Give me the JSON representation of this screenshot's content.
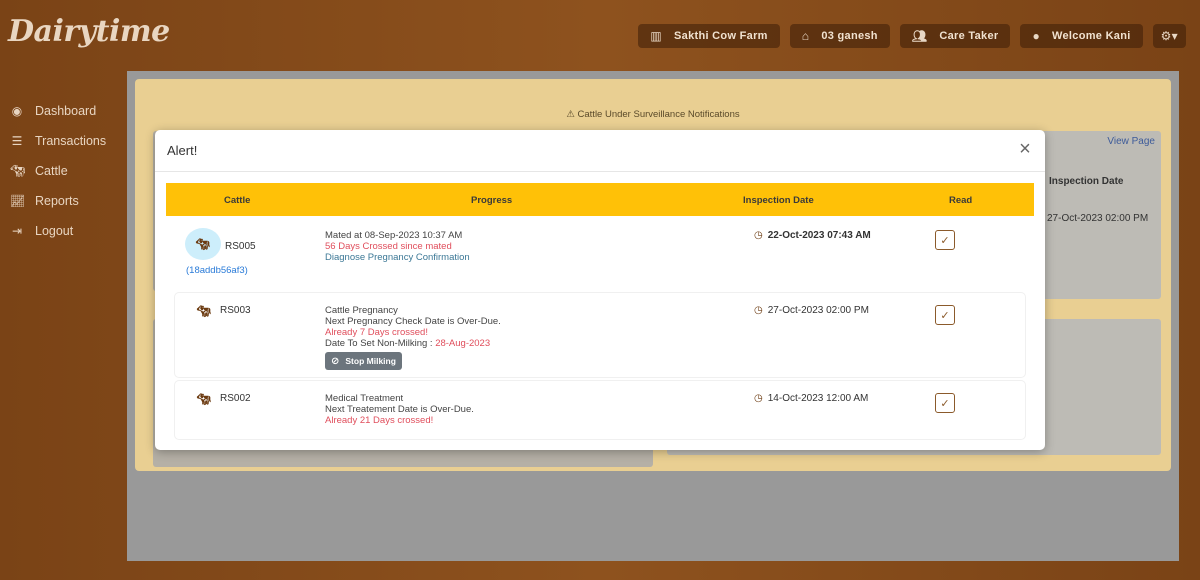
{
  "app": {
    "logo": "Dairytime"
  },
  "topbar": {
    "farm": "Sakthi Cow Farm",
    "shed": "03 ganesh",
    "role": "Care Taker",
    "welcome": "Welcome Kani"
  },
  "sidebar": {
    "items": [
      {
        "label": "Dashboard",
        "icon": "dashboard-icon"
      },
      {
        "label": "Transactions",
        "icon": "list-icon"
      },
      {
        "label": "Cattle",
        "icon": "cow-icon"
      },
      {
        "label": "Reports",
        "icon": "chart-icon"
      },
      {
        "label": "Logout",
        "icon": "logout-icon"
      }
    ]
  },
  "background": {
    "surveillance_title": "Cattle Under Surveillance Notifications",
    "view_page": "View Page",
    "inspection_date_header": "Inspection Date",
    "inspection_date_value": "27-Oct-2023 02:00 PM"
  },
  "modal": {
    "title": "Alert!",
    "close_symbol": "×",
    "columns": [
      "Cattle",
      "Progress",
      "Inspection Date",
      "Read"
    ],
    "rows": [
      {
        "cattle": "RS005",
        "tag": "(18addb56af3)",
        "line1": "Mated at 08-Sep-2023 10:37 AM",
        "line2": "56 Days Crossed since mated",
        "line3": "Diagnose Pregnancy Confirmation",
        "inspection": "22-Oct-2023 07:43 AM",
        "read": true
      },
      {
        "cattle": "RS003",
        "line1": "Cattle Pregnancy",
        "line2": "Next Pregnancy Check Date is Over-Due.",
        "line3": "Already 7 Days crossed!",
        "line4_label": "Date To Set Non-Milking : ",
        "line4_value": "28-Aug-2023",
        "button": "Stop Milking",
        "inspection": "27-Oct-2023 02:00 PM",
        "read": true
      },
      {
        "cattle": "RS002",
        "line1": "Medical Treatment",
        "line2": "Next Treatement Date is Over-Due.",
        "line3": "Already 21 Days crossed!",
        "inspection": "14-Oct-2023 12:00 AM",
        "read": true
      }
    ]
  },
  "colors": {
    "header_yellow": "#ffc107",
    "alert_red": "#e04e5c",
    "link_blue": "#2a7bd8",
    "brown": "#8e521e"
  }
}
